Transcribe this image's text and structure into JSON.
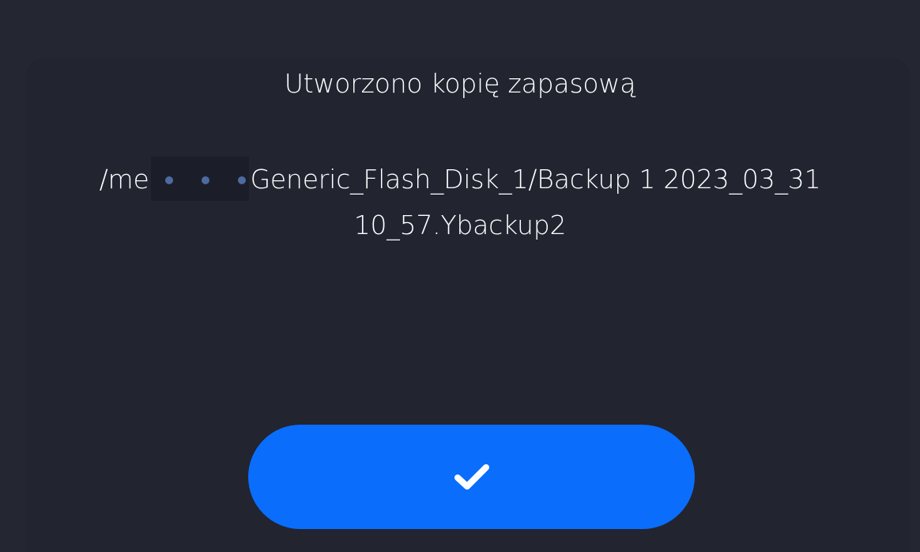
{
  "dialog": {
    "title": "Utworzono kopię zapasową",
    "path_prefix": "/me",
    "path_rest": "Generic_Flash_Disk_1/Backup 1 2023_03_31",
    "path_line2": "10_57.Ybackup2"
  },
  "confirm_button": {
    "icon": "check-icon"
  },
  "colors": {
    "background": "#242731",
    "dialog": "#222430",
    "accent": "#0a6dfb",
    "text": "#ffffff"
  }
}
